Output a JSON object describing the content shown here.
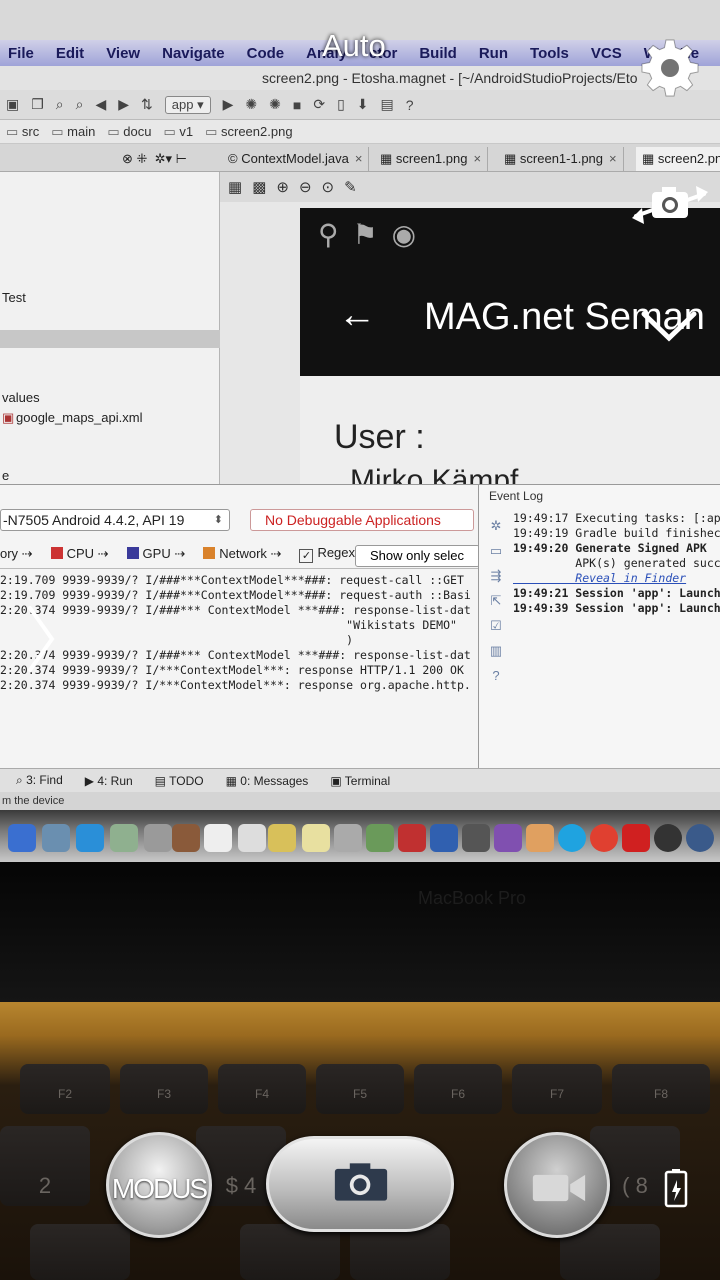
{
  "camera": {
    "scene_mode": "Auto",
    "modus_label": "MODUS"
  },
  "ide": {
    "menu": [
      "File",
      "Edit",
      "View",
      "Navigate",
      "Code",
      "Analy",
      "ctor",
      "Build",
      "Run",
      "Tools",
      "VCS",
      "W",
      "He"
    ],
    "window_title": "screen2.png - Etosha.magnet - [~/AndroidStudioProjects/Eto",
    "run_config": "app ▾",
    "breadcrumb": [
      "src",
      "main",
      "docu",
      "v1",
      "screen2.png"
    ],
    "tabs": [
      "ContextModel.java",
      "screen1.png",
      "screen1-1.png",
      "screen2.pn"
    ],
    "left_panel": {
      "item_test": "Test",
      "item_values": "values",
      "item_xml": "google_maps_api.xml",
      "item_e": "e"
    },
    "preview": {
      "title": "MAG.net Seman",
      "user_label": "User :",
      "user_name": "Mirko Kämpf"
    },
    "device": "-N7505 Android 4.4.2, API 19",
    "no_debug": "No Debuggable Applications",
    "monitor_tabs": {
      "memory": "ory",
      "cpu": "CPU",
      "gpu": "GPU",
      "network": "Network",
      "regex": "Regex",
      "show_only": "Show only selec"
    },
    "logcat": [
      "2:19.709 9939-9939/? I/###***ContextModel***###: request-call ::GET",
      "2:19.709 9939-9939/? I/###***ContextModel***###: request-auth ::Basi",
      "2:20.374 9939-9939/? I/###*** ContextModel ***###: response-list-dat",
      "                                                  \"Wikistats DEMO\"",
      "                                                  )",
      "2:20.374 9939-9939/? I/###*** ContextModel ***###: response-list-dat",
      "2:20.374 9939-9939/? I/***ContextModel***: response HTTP/1.1 200 OK",
      "2:20.374 9939-9939/? I/***ContextModel***: response org.apache.http."
    ],
    "event_log": {
      "title": "Event Log",
      "l1": "19:49:17 Executing tasks: [:ap",
      "l2": "19:49:19 Gradle build finishec",
      "l3": "19:49:20 Generate Signed APK",
      "l4": "         APK(s) generated succ",
      "l5": "         Reveal in Finder",
      "l6": "19:49:21 Session 'app': Launch",
      "l7": "19:49:39 Session 'app': Launch"
    },
    "statusbar": {
      "find": "3: Find",
      "run": "4: Run",
      "todo": "TODO",
      "messages": "0: Messages",
      "terminal": "Terminal"
    },
    "status_line": "m the device"
  },
  "laptop": {
    "brand": "MacBook Pro",
    "keys": [
      "F2",
      "F3",
      "F4",
      "F5",
      "F6",
      "F7",
      "F8",
      "2",
      "$ 4",
      "( 8"
    ]
  },
  "colors": {
    "overlay_text": "#ffffff",
    "error_text": "#cc2222",
    "link": "#2a4fb8"
  }
}
